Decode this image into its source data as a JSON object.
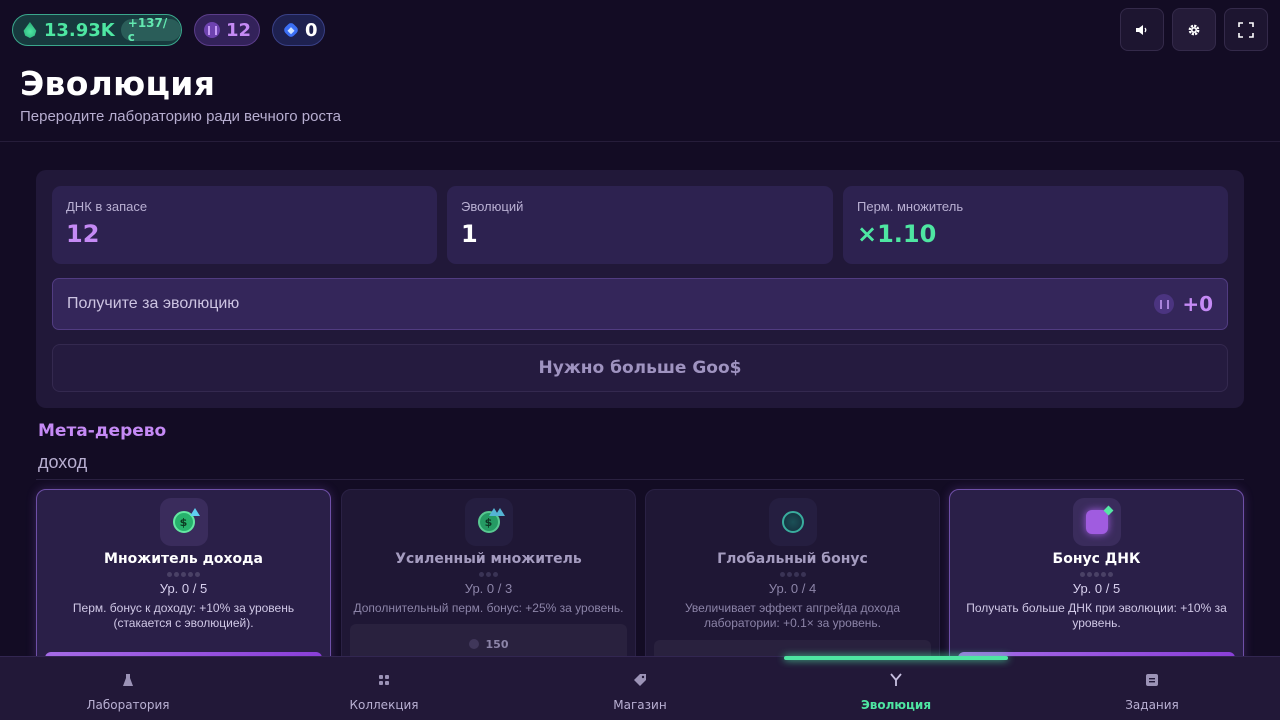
{
  "resources": {
    "goo": {
      "value": "13.93K",
      "rate": "+137/с",
      "icon": "goo-drop-icon",
      "color": "#4ee6a2"
    },
    "dna": {
      "value": "12",
      "icon": "dna-icon",
      "color": "#c58af5"
    },
    "gems": {
      "value": "0",
      "icon": "gem-icon",
      "color": "#ffffff"
    }
  },
  "toolbar": {
    "sound_icon": "speaker-icon",
    "settings_icon": "gear-icon",
    "fullscreen_icon": "fullscreen-icon"
  },
  "header": {
    "title": "Эволюция",
    "subtitle": "Перероди­те лабораторию ради вечного роста"
  },
  "evolution": {
    "stats": [
      {
        "label": "ДНК в запасе",
        "value": "12"
      },
      {
        "label": "Эволюций",
        "value": "1"
      },
      {
        "label": "Перм. множитель",
        "value": "×1.10"
      }
    ],
    "reward_label": "Получите за эволюцию",
    "reward_value": "+0",
    "button_label": "Нужно больше Goo$"
  },
  "meta_tree": {
    "title": "Мета-дерево",
    "category": "доход",
    "cards": [
      {
        "title": "Множитель дохода",
        "level": "Ур. 0 / 5",
        "max_level": 5,
        "current_level": 0,
        "description": "Перм. бонус к доходу: +10% за уровень (стакается с эволюцией).",
        "icon": "coin-upgrade-icon",
        "state": "available"
      },
      {
        "title": "Усиленный множитель",
        "level": "Ур. 0 / 3",
        "max_level": 3,
        "current_level": 0,
        "description": "Дополнительный перм. бонус: +25% за уровень.",
        "icon": "coin-double-upgrade-icon",
        "state": "locked",
        "cost": "150"
      },
      {
        "title": "Глобальный бонус",
        "level": "Ур. 0 / 4",
        "max_level": 4,
        "current_level": 0,
        "description": "Увеличивает эффект апгрейда дохода лаборатории: +0.1× за уровень.",
        "icon": "globe-icon",
        "state": "locked"
      },
      {
        "title": "Бонус ДНК",
        "level": "Ур. 0 / 5",
        "max_level": 5,
        "current_level": 0,
        "description": "Получать больше ДНК при эволюции: +10% за уровень.",
        "icon": "dna-sparkle-icon",
        "state": "available"
      }
    ]
  },
  "nav": {
    "items": [
      {
        "label": "Лаборатория",
        "icon": "flask-icon"
      },
      {
        "label": "Коллекция",
        "icon": "grid-icon"
      },
      {
        "label": "Магазин",
        "icon": "tag-icon"
      },
      {
        "label": "Эволюция",
        "icon": "evolution-icon",
        "active": true
      },
      {
        "label": "Задания",
        "icon": "tasks-icon"
      }
    ]
  }
}
